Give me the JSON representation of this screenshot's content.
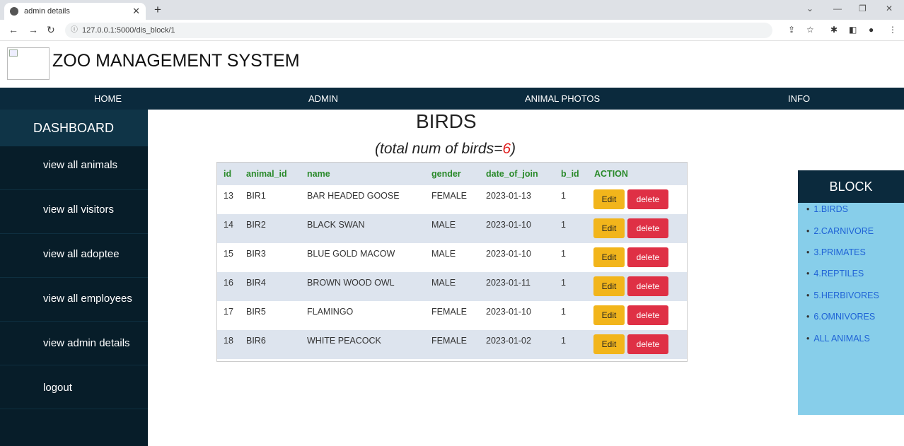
{
  "browser": {
    "tab_title": "admin details",
    "url": "127.0.0.1:5000/dis_block/1",
    "new_tab_label": "+"
  },
  "header": {
    "title": "ZOO MANAGEMENT SYSTEM"
  },
  "topnav": [
    "HOME",
    "ADMIN",
    "ANIMAL PHOTOS",
    "INFO"
  ],
  "sidebar": {
    "heading": "DASHBOARD",
    "items": [
      "view all animals",
      "view all visitors",
      "view all adoptee",
      "view all employees",
      "view admin details",
      "logout"
    ]
  },
  "main": {
    "title": "BIRDS",
    "subtitle_prefix": "(total num of birds=",
    "count": "6",
    "subtitle_suffix": ")"
  },
  "table": {
    "columns": [
      "id",
      "animal_id",
      "name",
      "gender",
      "date_of_join",
      "b_id",
      "ACTION"
    ],
    "rows": [
      [
        "13",
        "BIR1",
        "BAR HEADED GOOSE",
        "FEMALE",
        "2023-01-13",
        "1"
      ],
      [
        "14",
        "BIR2",
        "BLACK SWAN",
        "MALE",
        "2023-01-10",
        "1"
      ],
      [
        "15",
        "BIR3",
        "BLUE GOLD MACOW",
        "MALE",
        "2023-01-10",
        "1"
      ],
      [
        "16",
        "BIR4",
        "BROWN WOOD OWL",
        "MALE",
        "2023-01-11",
        "1"
      ],
      [
        "17",
        "BIR5",
        "FLAMINGO",
        "FEMALE",
        "2023-01-10",
        "1"
      ],
      [
        "18",
        "BIR6",
        "WHITE PEACOCK",
        "FEMALE",
        "2023-01-02",
        "1"
      ]
    ],
    "edit_label": "Edit",
    "delete_label": "delete"
  },
  "block_panel": {
    "heading": "BLOCK",
    "items": [
      "1.BIRDS",
      "2.CARNIVORE",
      "3.PRIMATES",
      "4.REPTILES",
      "5.HERBIVORES",
      "6.OMNIVORES",
      "ALL ANIMALS"
    ]
  },
  "colors": {
    "nav_bg": "#0b2a3d",
    "sidebar_bg": "#071d29",
    "header_green": "#2a8a2a",
    "edit_yellow": "#f2b51b",
    "delete_red": "#df3045",
    "panel_blue": "#87ceea",
    "link_blue": "#1f63d6"
  }
}
